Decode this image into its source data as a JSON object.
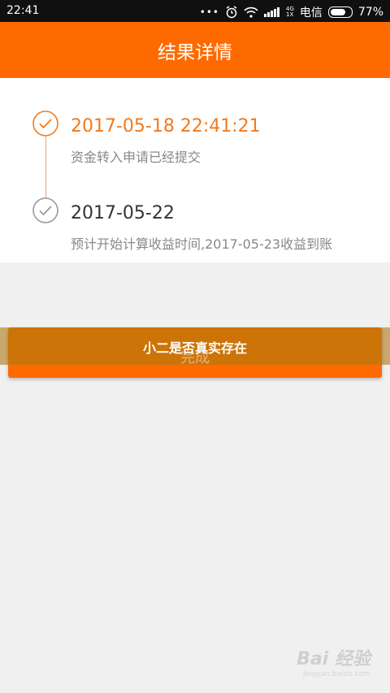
{
  "status_bar": {
    "time": "22:41",
    "carrier": "电信",
    "battery": "77%",
    "battery_level": 0.77,
    "network_top": "4G",
    "network_bottom": "1X",
    "icons": [
      "notification-dots-icon",
      "alarm-icon",
      "wifi-icon",
      "signal-icon",
      "battery-icon"
    ]
  },
  "header": {
    "title": "结果详情"
  },
  "timeline": [
    {
      "time": "2017-05-18 22:41:21",
      "desc": "资金转入申请已经提交",
      "status": "active",
      "color": "#f07a1e"
    },
    {
      "time": "2017-05-22",
      "desc": "预计开始计算收益时间,2017-05-23收益到账",
      "status": "pending",
      "color": "#333333"
    }
  ],
  "done_button": {
    "label": "完成"
  },
  "popup": {
    "text": "小二是否真实存在"
  },
  "watermark": {
    "text": "Bai 经验",
    "sub": "jingyan.baidu.com"
  },
  "colors": {
    "accent": "#ff6a00",
    "line": "#f0a270"
  }
}
